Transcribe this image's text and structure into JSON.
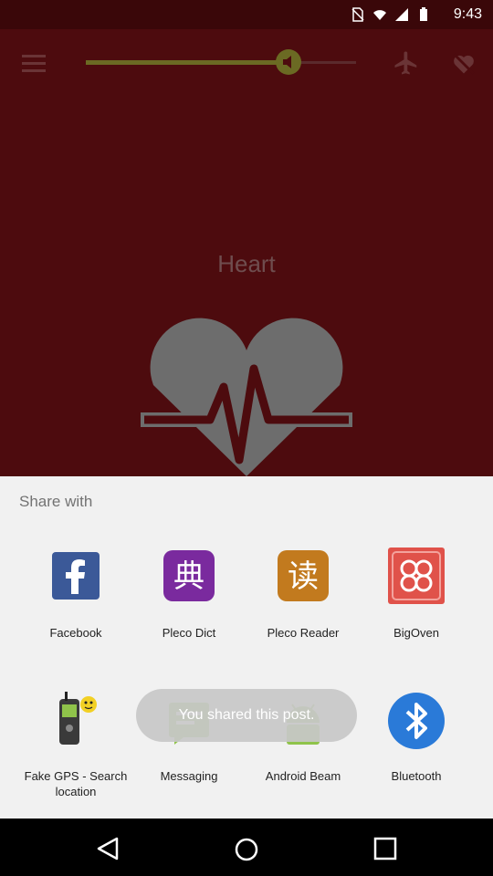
{
  "status_bar": {
    "time": "9:43"
  },
  "app": {
    "title": "Heart"
  },
  "share_sheet": {
    "title": "Share with",
    "apps": [
      {
        "label": "Facebook",
        "icon": "facebook-icon"
      },
      {
        "label": "Pleco Dict",
        "icon": "pleco-dict-icon"
      },
      {
        "label": "Pleco Reader",
        "icon": "pleco-reader-icon"
      },
      {
        "label": "BigOven",
        "icon": "bigoven-icon"
      },
      {
        "label": "Fake GPS - Search location",
        "icon": "fake-gps-icon"
      },
      {
        "label": "Messaging",
        "icon": "messaging-icon"
      },
      {
        "label": "Android Beam",
        "icon": "android-beam-icon"
      },
      {
        "label": "Bluetooth",
        "icon": "bluetooth-icon"
      }
    ]
  },
  "toast": {
    "text": "You shared this post."
  },
  "volume_level": 0.75,
  "colors": {
    "dim_background": "#4d0b0e",
    "sheet_background": "#f1f1f1",
    "facebook": "#3b5998",
    "pleco_dict": "#7a2a9e",
    "pleco_reader": "#c27a1e",
    "bigoven": "#e0524a",
    "bluetooth": "#2a7ad8"
  }
}
